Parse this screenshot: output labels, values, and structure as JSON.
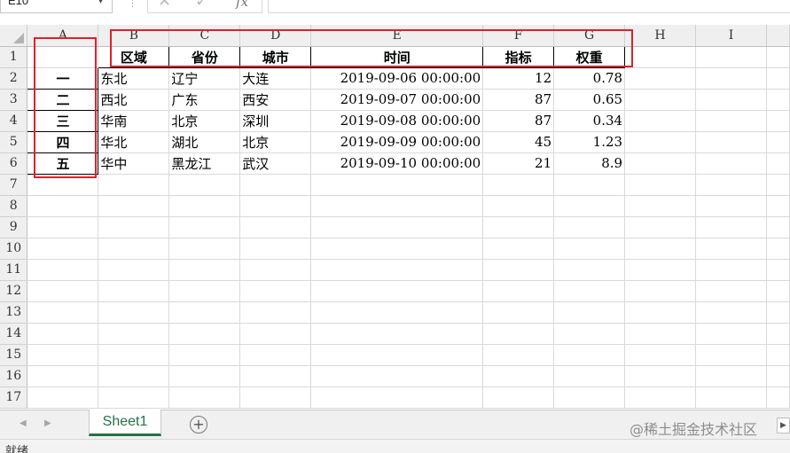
{
  "formula_bar": {
    "name_box": "E10",
    "name_box_arrow": "▾",
    "separator": "⋮",
    "cancel_icon": "✕",
    "enter_icon": "✓",
    "fx_label": "fx",
    "formula": ""
  },
  "columns": [
    "A",
    "B",
    "C",
    "D",
    "E",
    "F",
    "G",
    "H",
    "I"
  ],
  "rows": [
    [
      "",
      "区域",
      "省份",
      "城市",
      "时间",
      "指标",
      "权重",
      "",
      ""
    ],
    [
      "一",
      "东北",
      "辽宁",
      "大连",
      "2019-09-06 00:00:00",
      "12",
      "0.78",
      "",
      ""
    ],
    [
      "二",
      "西北",
      "广东",
      "西安",
      "2019-09-07 00:00:00",
      "87",
      "0.65",
      "",
      ""
    ],
    [
      "三",
      "华南",
      "北京",
      "深圳",
      "2019-09-08 00:00:00",
      "87",
      "0.34",
      "",
      ""
    ],
    [
      "四",
      "华北",
      "湖北",
      "北京",
      "2019-09-09 00:00:00",
      "45",
      "1.23",
      "",
      ""
    ],
    [
      "五",
      "华中",
      "黑龙江",
      "武汉",
      "2019-09-10 00:00:00",
      "21",
      "8.9",
      "",
      ""
    ],
    [
      "",
      "",
      "",
      "",
      "",
      "",
      "",
      "",
      ""
    ],
    [
      "",
      "",
      "",
      "",
      "",
      "",
      "",
      "",
      ""
    ],
    [
      "",
      "",
      "",
      "",
      "",
      "",
      "",
      "",
      ""
    ],
    [
      "",
      "",
      "",
      "",
      "",
      "",
      "",
      "",
      ""
    ],
    [
      "",
      "",
      "",
      "",
      "",
      "",
      "",
      "",
      ""
    ],
    [
      "",
      "",
      "",
      "",
      "",
      "",
      "",
      "",
      ""
    ],
    [
      "",
      "",
      "",
      "",
      "",
      "",
      "",
      "",
      ""
    ],
    [
      "",
      "",
      "",
      "",
      "",
      "",
      "",
      "",
      ""
    ],
    [
      "",
      "",
      "",
      "",
      "",
      "",
      "",
      "",
      ""
    ],
    [
      "",
      "",
      "",
      "",
      "",
      "",
      "",
      "",
      ""
    ],
    [
      "",
      "",
      "",
      "",
      "",
      "",
      "",
      "",
      ""
    ]
  ],
  "row_numbers": [
    "1",
    "2",
    "3",
    "4",
    "5",
    "6",
    "7",
    "8",
    "9",
    "10",
    "11",
    "12",
    "13",
    "14",
    "15",
    "16",
    "17"
  ],
  "tab_bar": {
    "prev_icon": "◀",
    "next_icon": "▶",
    "sheet_tab": "Sheet1",
    "add_sheet_icon": "+",
    "watermark": "@稀土掘金技术社区",
    "scroll_right_icon": "▶"
  },
  "status_bar": {
    "status": "就绪"
  },
  "colors": {
    "accent_green": "#217346",
    "annotation_red": "#e0202a",
    "header_gray": "#efefef"
  }
}
